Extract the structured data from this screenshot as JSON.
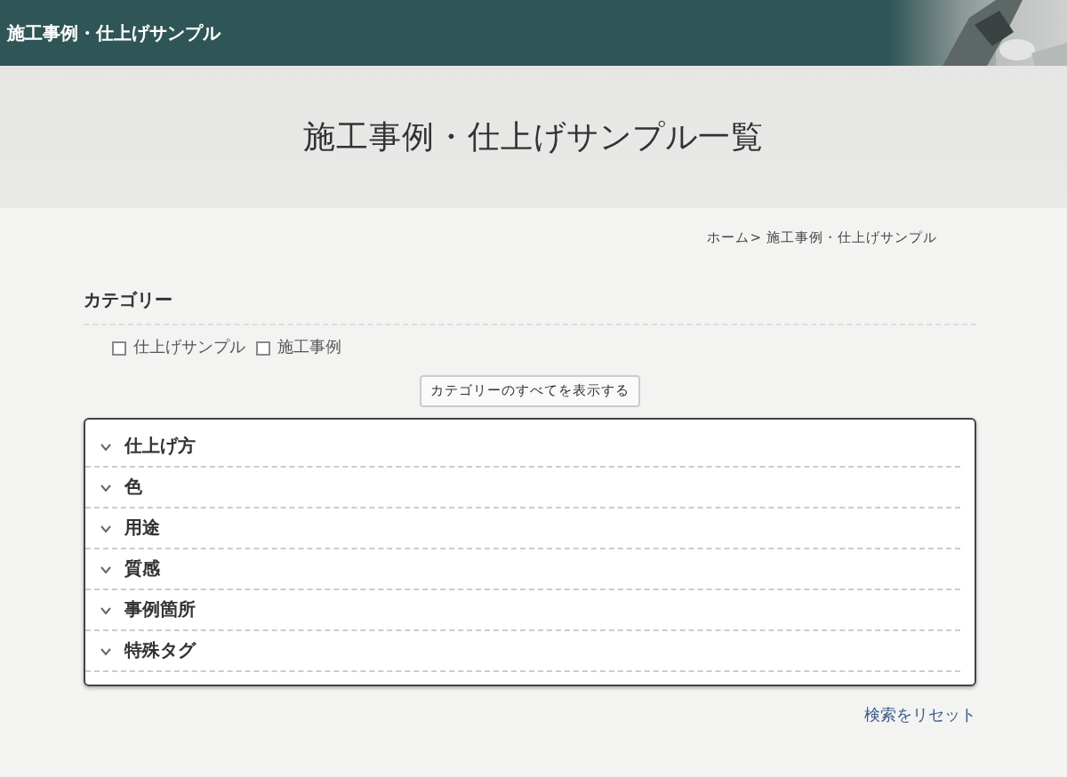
{
  "header": {
    "site_title": "施工事例・仕上げサンプル"
  },
  "hero": {
    "title": "施工事例・仕上げサンプル一覧"
  },
  "breadcrumb": [
    {
      "label": "ホーム>"
    },
    {
      "label": "施工事例・仕上げサンプル"
    }
  ],
  "category": {
    "heading": "カテゴリー",
    "options": [
      {
        "label": "仕上げサンプル",
        "checked": false
      },
      {
        "label": "施工事例",
        "checked": false
      }
    ],
    "show_all_button": "カテゴリーのすべてを表示する"
  },
  "filters": [
    {
      "label": "仕上げ方",
      "expanded": false
    },
    {
      "label": "色",
      "expanded": false
    },
    {
      "label": "用途",
      "expanded": false
    },
    {
      "label": "質感",
      "expanded": false
    },
    {
      "label": "事例箇所",
      "expanded": false
    },
    {
      "label": "特殊タグ",
      "expanded": false
    }
  ],
  "reset_link": "検索をリセット"
}
